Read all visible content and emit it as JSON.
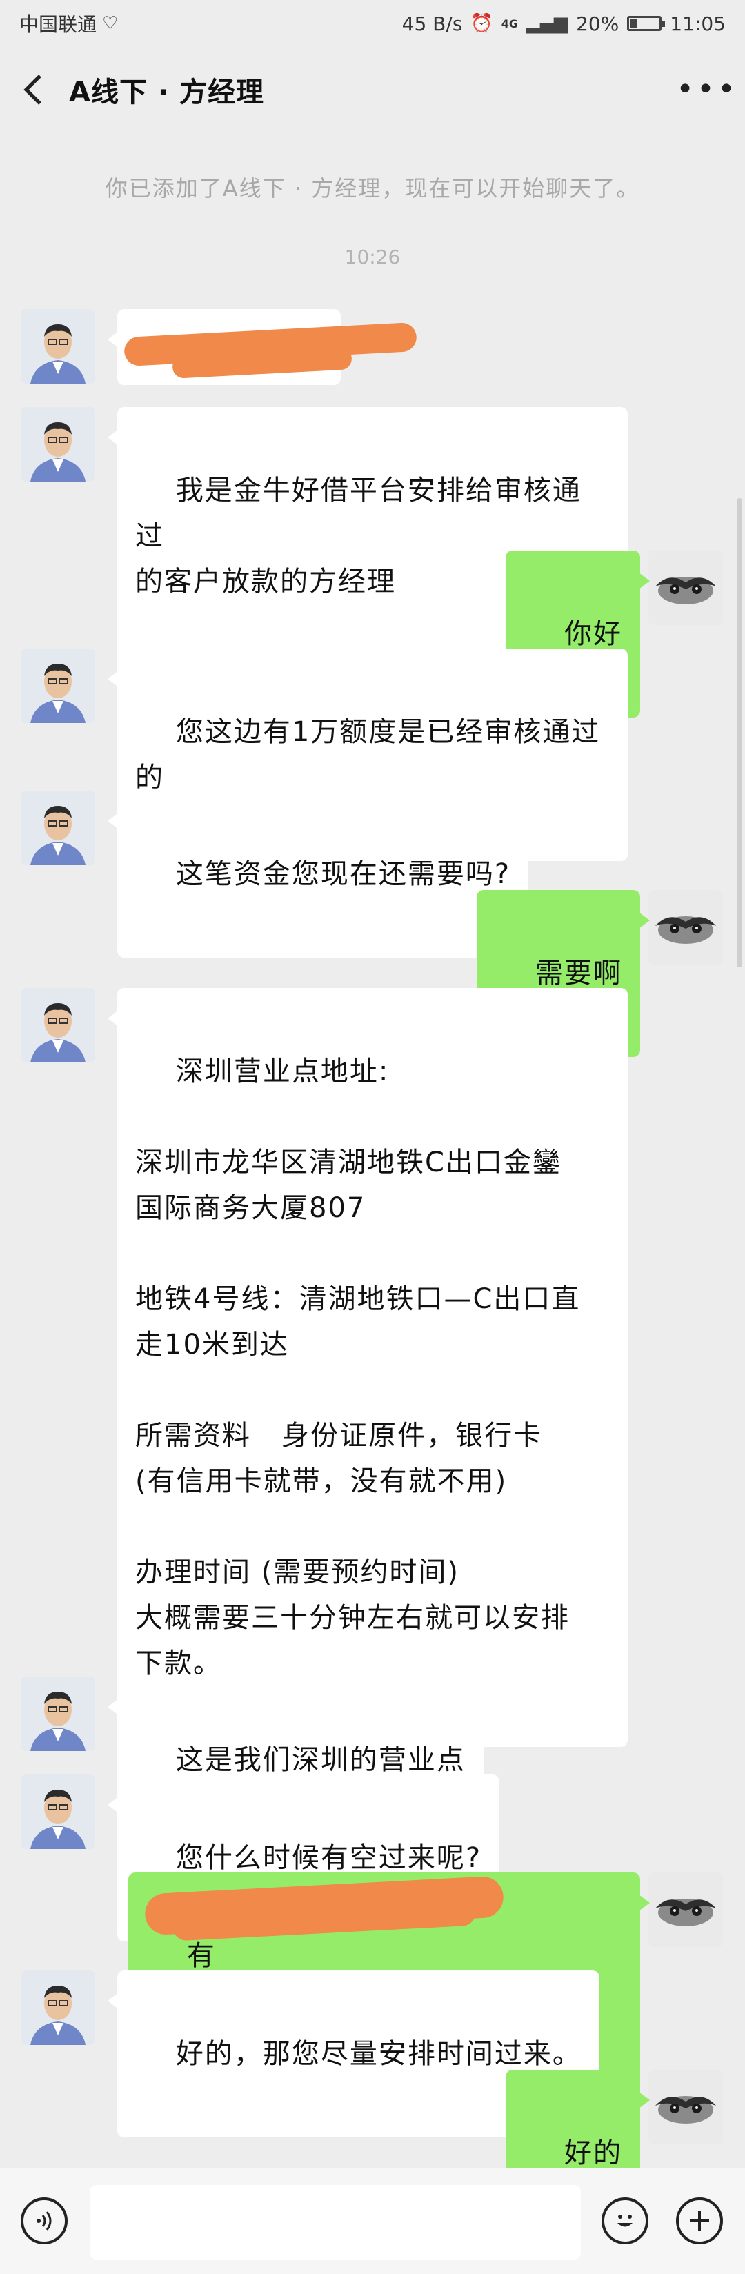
{
  "status_bar": {
    "carrier": "中国联通",
    "speed": "45 B/s",
    "network": "4G",
    "battery": "20%",
    "time": "11:05"
  },
  "header": {
    "title": "A线下 · 方经理"
  },
  "chat": {
    "system_notice": "你已添加了A线下 · 方经理，现在可以开始聊天了。",
    "timestamp": "10:26",
    "messages": [
      {
        "from": "agent",
        "text": ""
      },
      {
        "from": "agent",
        "text": "我是金牛好借平台安排给审核通过\n的客户放款的方经理"
      },
      {
        "from": "me",
        "text": "你好"
      },
      {
        "from": "agent",
        "text": "您这边有1万额度是已经审核通过\n的"
      },
      {
        "from": "agent",
        "text": "这笔资金您现在还需要吗?"
      },
      {
        "from": "me",
        "text": "需要啊"
      },
      {
        "from": "agent",
        "text": "深圳营业点地址:\n\n深圳市龙华区清湖地铁C出口金鑾\n国际商务大厦807\n\n地铁4号线：清湖地铁口—C出口直\n走10米到达\n\n所需资料   身份证原件，银行卡\n(有信用卡就带，没有就不用)\n\n办理时间 (需要预约时间)\n大概需要三十分钟左右就可以安排\n下款。"
      },
      {
        "from": "agent",
        "text": "这是我们深圳的营业点"
      },
      {
        "from": "agent",
        "text": "您什么时候有空过来呢?"
      },
      {
        "from": "me",
        "text": "有                                      以吗?"
      },
      {
        "from": "agent",
        "text": "好的，那您尽量安排时间过来。"
      },
      {
        "from": "me",
        "text": "好的"
      }
    ]
  },
  "input_bar": {
    "voice_icon": "voice-icon",
    "emoji_icon": "emoji-icon",
    "plus_icon": "plus-icon"
  },
  "colors": {
    "background": "#ededed",
    "bubble_out": "#95ec69",
    "bubble_in": "#ffffff",
    "redaction": "#f0894a"
  }
}
